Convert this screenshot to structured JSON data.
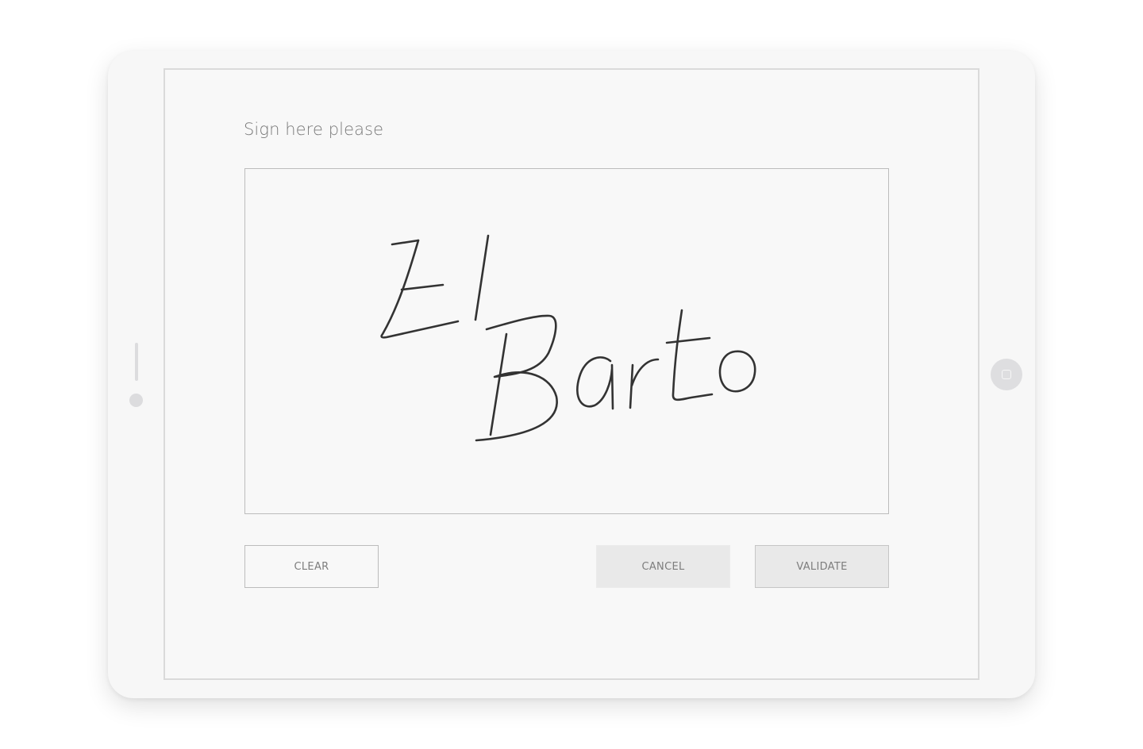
{
  "form": {
    "prompt": "Sign here please",
    "signature_text": "El Barto"
  },
  "buttons": {
    "clear": "CLEAR",
    "cancel": "CANCEL",
    "validate": "VALIDATE"
  },
  "colors": {
    "ink": "#333333",
    "device": "#f7f7f7",
    "screen": "#f8f8f8",
    "border": "#bcbcbc"
  }
}
